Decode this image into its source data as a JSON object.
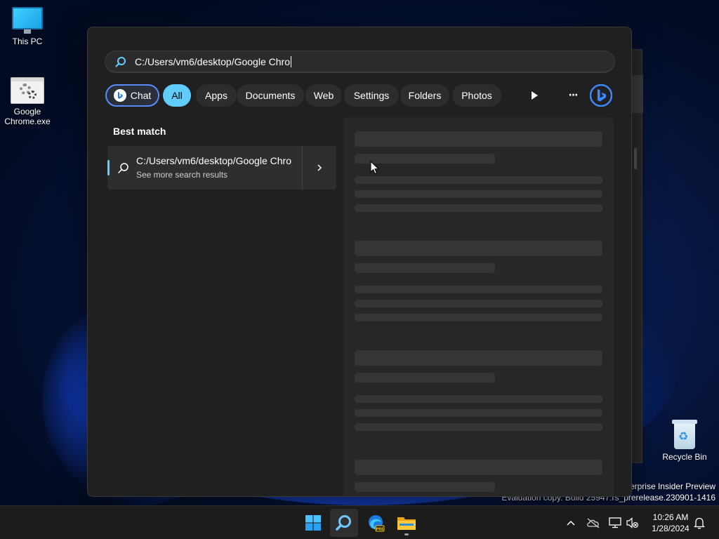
{
  "desktop": {
    "icons": [
      {
        "label": "This PC",
        "icon": "this-pc-icon"
      },
      {
        "label": "Google\nChrome.exe",
        "icon": "exe-file-icon"
      },
      {
        "label": "Recycle Bin",
        "icon": "recycle-bin-icon"
      }
    ],
    "watermark": {
      "line1": "nterprise Insider Preview",
      "line2": "Evaluation copy. Build 25947.rs_prerelease.230901-1416"
    }
  },
  "search": {
    "query": "C:/Users/vm6/desktop/Google Chro",
    "filters": [
      {
        "label": "Chat",
        "selected": false
      },
      {
        "label": "All",
        "selected": true
      },
      {
        "label": "Apps",
        "selected": false
      },
      {
        "label": "Documents",
        "selected": false
      },
      {
        "label": "Web",
        "selected": false
      },
      {
        "label": "Settings",
        "selected": false
      },
      {
        "label": "Folders",
        "selected": false
      },
      {
        "label": "Photos",
        "selected": false
      }
    ],
    "more_label": "···",
    "best_match_heading": "Best match",
    "best_match": {
      "title": "C:/Users/vm6/desktop/Google Chro",
      "subtitle": "See more search results"
    },
    "preview_state": "loading"
  },
  "colors": {
    "accent": "#60cdff",
    "panel": "#202020",
    "chat_border": "#5b8cff"
  },
  "taskbar": {
    "apps": [
      "start-icon",
      "search-icon",
      "edge-dev-icon",
      "file-explorer-icon"
    ],
    "tray": [
      "chevron-up-icon",
      "onedrive-icon",
      "network-icon",
      "volume-muted-icon",
      "notification-icon"
    ],
    "time": "10:26 AM",
    "date": "1/28/2024"
  }
}
